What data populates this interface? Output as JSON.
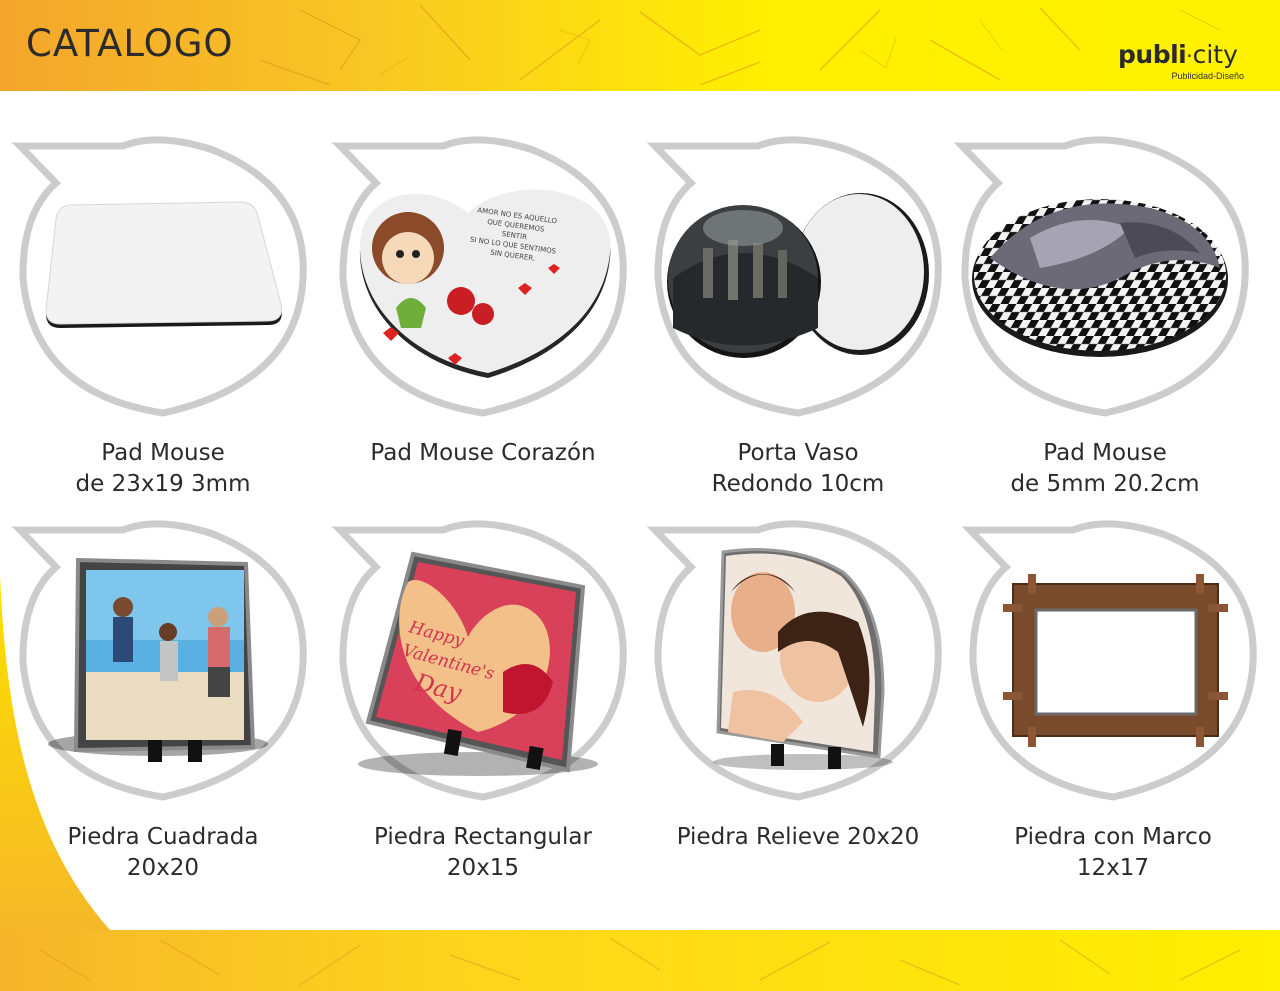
{
  "header": {
    "title": "CATALOGO",
    "logo_bold": "publi",
    "logo_dot": "·",
    "logo_light": "city",
    "logo_tagline": "Publicidad-Diseño"
  },
  "colors": {
    "header_orange": "#f4a52b",
    "header_yellow": "#fff200",
    "frame_gray": "#cccccc",
    "text_dark": "#2b2b2b"
  },
  "items": [
    {
      "name_line1": "Pad Mouse",
      "name_line2": "de 23x19 3mm"
    },
    {
      "name_line1": "Pad Mouse Corazón",
      "name_line2": ""
    },
    {
      "name_line1": "Porta Vaso",
      "name_line2": "Redondo 10cm"
    },
    {
      "name_line1": "Pad Mouse",
      "name_line2": "de 5mm 20.2cm"
    },
    {
      "name_line1": "Piedra Cuadrada",
      "name_line2": "20x20"
    },
    {
      "name_line1": "Piedra Rectangular",
      "name_line2": "20x15"
    },
    {
      "name_line1": "Piedra Relieve 20x20",
      "name_line2": ""
    },
    {
      "name_line1": "Piedra con Marco",
      "name_line2": "12x17"
    }
  ],
  "product_images": {
    "heart_pad_text": [
      "AMOR NO ES AQUELLO",
      "QUE QUEREMOS",
      "SENTIR",
      "SI NO LO QUE SENTIMOS",
      "SIN QUERER."
    ],
    "valentine_text": [
      "Happy",
      "Valentine's",
      "Day"
    ]
  }
}
